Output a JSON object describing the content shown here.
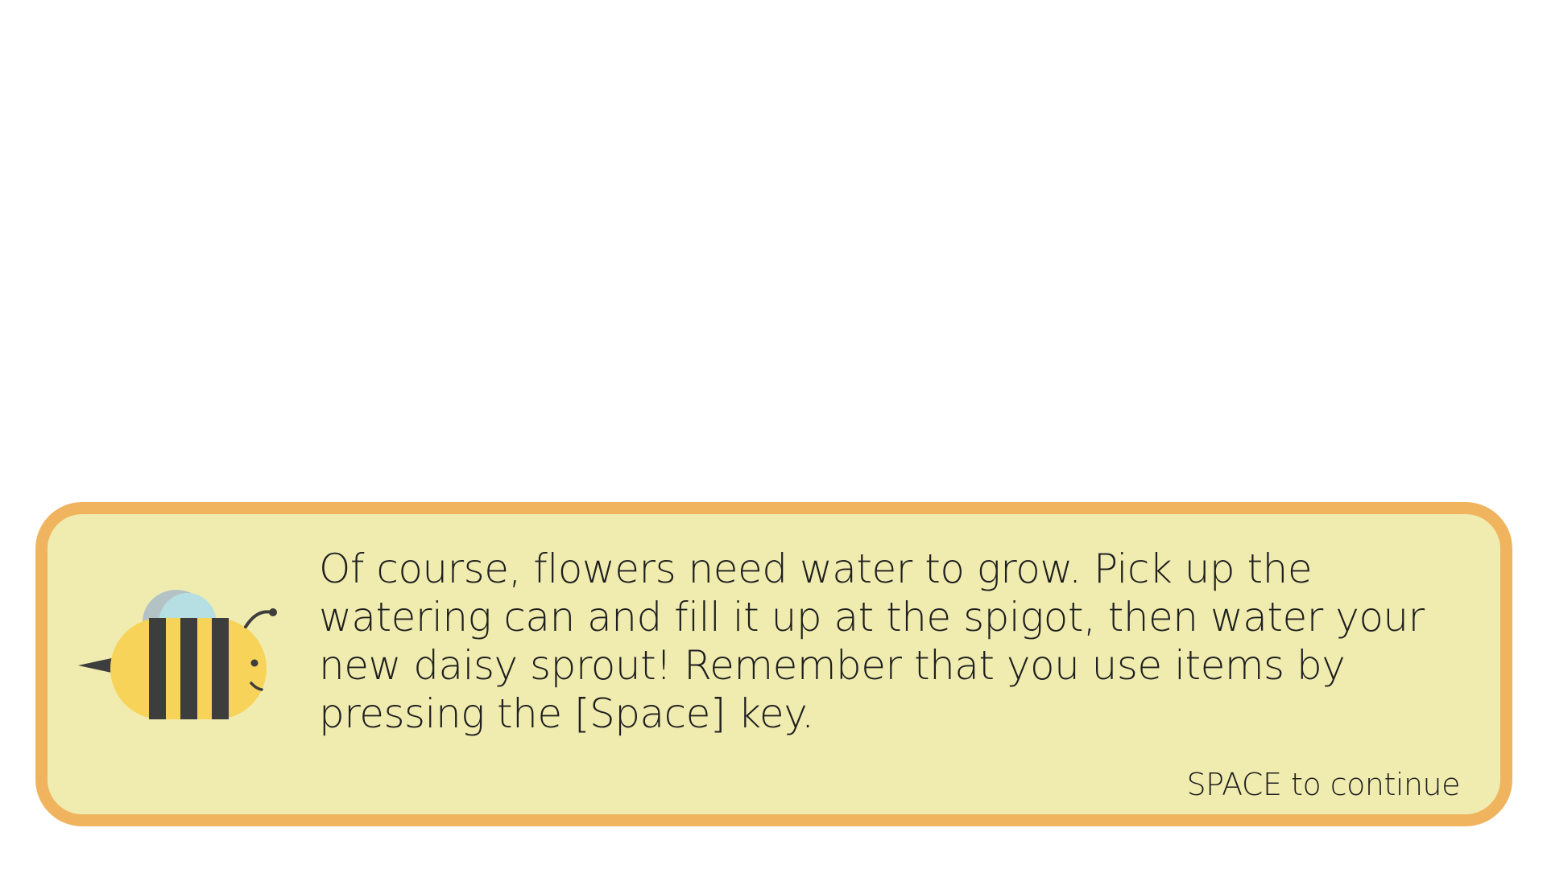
{
  "dialog": {
    "speaker_icon": "bee-icon",
    "text": "Of course, flowers need water to grow. Pick up the watering can and fill it up at the spigot, then water your new daisy sprout! Remember that you use items by pressing the [Space] key.",
    "continue_prompt": "SPACE to continue"
  },
  "colors": {
    "background": "#ffffff",
    "dialog_fill": "#f0ecb0",
    "dialog_border": "#f0b45f",
    "bee_body": "#f8d35a",
    "bee_stripes": "#3d3d3d",
    "bee_wing_front": "#b6dfe4",
    "bee_wing_back": "#b3c3c5",
    "text": "#1f1f1f"
  }
}
